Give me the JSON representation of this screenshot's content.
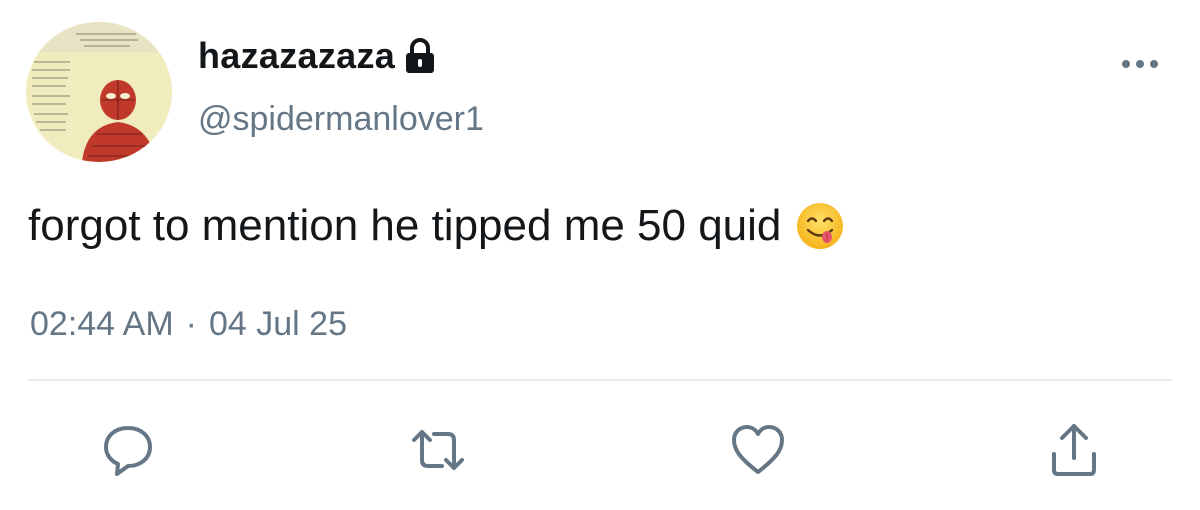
{
  "user": {
    "display_name": "hazazazaza",
    "handle": "@spidermanlover1",
    "protected_icon": "lock-icon",
    "avatar": "spiderman-drawing-avatar"
  },
  "tweet": {
    "text": "forgot to mention he tipped me 50 quid",
    "emoji": "face-savoring-food-emoji",
    "time": "02:44 AM",
    "separator": "·",
    "date": "04 Jul 25"
  },
  "actions": [
    {
      "name": "reply",
      "icon": "reply-icon"
    },
    {
      "name": "retweet",
      "icon": "retweet-icon"
    },
    {
      "name": "like",
      "icon": "heart-icon"
    },
    {
      "name": "share",
      "icon": "share-icon"
    }
  ],
  "colors": {
    "text_primary": "#14171a",
    "text_secondary": "#657786",
    "divider": "#e6ecf0"
  }
}
